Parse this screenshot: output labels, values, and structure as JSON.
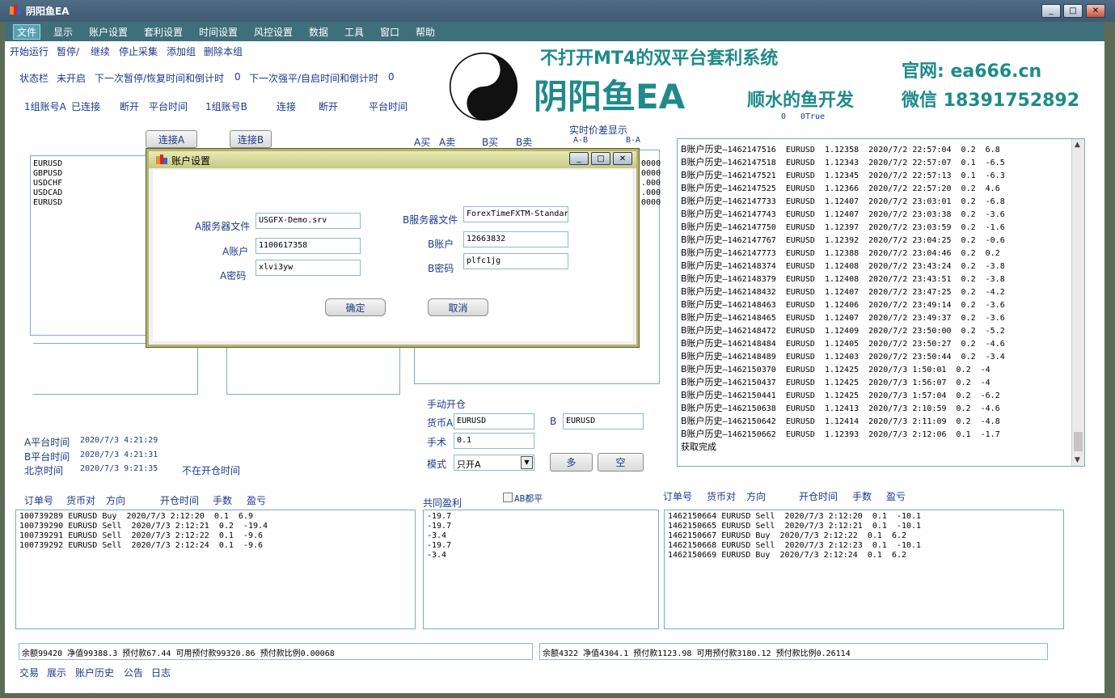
{
  "window": {
    "title": "阴阳鱼EA",
    "min": "_",
    "max": "□",
    "close": "✕"
  },
  "menu": [
    "文件",
    "显示",
    "账户设置",
    "套利设置",
    "时间设置",
    "风控设置",
    "数据",
    "工具",
    "窗口",
    "帮助"
  ],
  "toolbar": [
    "开始运行",
    "暂停/",
    "继续",
    "停止采集",
    "添加组",
    "删除本组"
  ],
  "status": {
    "label": "状态栏",
    "state": "未开启",
    "next_pause": "下一次暂停/恢复时间和倒计时",
    "next_pause_val": "0",
    "next_force": "下一次强平/自启时间和倒计时",
    "next_force_val": "0"
  },
  "group_line": {
    "a_label": "1组账号A",
    "a_state": "已连接",
    "a_disc": "断开",
    "a_time": "平台时间",
    "b_label": "1组账号B",
    "b_conn": "连接",
    "b_disc": "断开",
    "b_time": "平台时间"
  },
  "banner": {
    "slogan": "不打开MT4的双平台套利系统",
    "brand": "阴阳鱼EA",
    "site": "官网: ea666.cn",
    "dev": "顺水的鱼开发",
    "wechat": "微信 18391752892"
  },
  "misc": {
    "zero": "0",
    "otrue": "0True"
  },
  "buttons": {
    "connect_a": "连接A",
    "connect_b": "连接B",
    "long": "多",
    "short": "空",
    "ok": "确定",
    "cancel": "取消"
  },
  "price_table": {
    "title": "实时价差显示",
    "cols": [
      "A买",
      "A卖",
      "B买",
      "B卖",
      "A-B",
      "B-A"
    ],
    "partial": [
      ".0000",
      ".0000",
      ".000",
      ".000",
      ".0000"
    ]
  },
  "symbols": [
    "EURUSD",
    "GBPUSD",
    "USDCHF",
    "USDCAD",
    "EURUSD"
  ],
  "times": {
    "a_label": "A平台时间",
    "a_val": "2020/7/3 4:21:29",
    "b_label": "B平台时间",
    "b_val": "2020/7/3 4:21:31",
    "bj_label": "北京时间",
    "bj_val": "2020/7/3 9:21:35",
    "not_open": "不在开仓时间"
  },
  "manual": {
    "title": "手动开仓",
    "symbol_a_label": "货币A",
    "symbol_a": "EURUSD",
    "b_label": "B",
    "symbol_b": "EURUSD",
    "lots_label": "手术",
    "lots": "0.1",
    "mode_label": "模式",
    "mode": "只开A"
  },
  "history": [
    [
      "B账户历史",
      "—1462147516  EURUSD  1.12358  2020/7/2 22:57:04  0.2  6.8"
    ],
    [
      "B账户历史",
      "—1462147518  EURUSD  1.12343  2020/7/2 22:57:07  0.1  -6.5"
    ],
    [
      "B账户历史",
      "—1462147521  EURUSD  1.12345  2020/7/2 22:57:13  0.1  -6.3"
    ],
    [
      "B账户历史",
      "—1462147525  EURUSD  1.12366  2020/7/2 22:57:20  0.2  4.6"
    ],
    [
      "B账户历史",
      "—1462147733  EURUSD  1.12407  2020/7/2 23:03:01  0.2  -6.8"
    ],
    [
      "B账户历史",
      "—1462147743  EURUSD  1.12407  2020/7/2 23:03:38  0.2  -3.6"
    ],
    [
      "B账户历史",
      "—1462147750  EURUSD  1.12397  2020/7/2 23:03:59  0.2  -1.6"
    ],
    [
      "B账户历史",
      "—1462147767  EURUSD  1.12392  2020/7/2 23:04:25  0.2  -0.6"
    ],
    [
      "B账户历史",
      "—1462147773  EURUSD  1.12388  2020/7/2 23:04:46  0.2  0.2"
    ],
    [
      "B账户历史",
      "—1462148374  EURUSD  1.12408  2020/7/2 23:43:24  0.2  -3.8"
    ],
    [
      "B账户历史",
      "—1462148379  EURUSD  1.12408  2020/7/2 23:43:51  0.2  -3.8"
    ],
    [
      "B账户历史",
      "—1462148432  EURUSD  1.12407  2020/7/2 23:47:25  0.2  -4.2"
    ],
    [
      "B账户历史",
      "—1462148463  EURUSD  1.12406  2020/7/2 23:49:14  0.2  -3.6"
    ],
    [
      "B账户历史",
      "—1462148465  EURUSD  1.12407  2020/7/2 23:49:37  0.2  -3.6"
    ],
    [
      "B账户历史",
      "—1462148472  EURUSD  1.12409  2020/7/2 23:50:00  0.2  -5.2"
    ],
    [
      "B账户历史",
      "—1462148484  EURUSD  1.12405  2020/7/2 23:50:27  0.2  -4.6"
    ],
    [
      "B账户历史",
      "—1462148489  EURUSD  1.12403  2020/7/2 23:50:44  0.2  -3.4"
    ],
    [
      "B账户历史",
      "—1462150370  EURUSD  1.12425  2020/7/3 1:50:01  0.2  -4"
    ],
    [
      "B账户历史",
      "—1462150437  EURUSD  1.12425  2020/7/3 1:56:07  0.2  -4"
    ],
    [
      "B账户历史",
      "—1462150441  EURUSD  1.12425  2020/7/3 1:57:04  0.2  -6.2"
    ],
    [
      "B账户历史",
      "—1462150638  EURUSD  1.12413  2020/7/3 2:10:59  0.2  -4.6"
    ],
    [
      "B账户历史",
      "—1462150642  EURUSD  1.12414  2020/7/3 2:11:09  0.2  -4.8"
    ],
    [
      "B账户历史",
      "—1462150662  EURUSD  1.12393  2020/7/3 2:12:06  0.1  -1.7"
    ]
  ],
  "history_done": "获取完成",
  "order_cols": [
    "订单号",
    "货币对",
    "方向",
    "开仓时间",
    "手数",
    "盈亏"
  ],
  "orders_a": [
    "100739289 EURUSD Buy  2020/7/3 2:12:20  0.1  6.9",
    "100739290 EURUSD Sell  2020/7/3 2:12:21  0.2  -19.4",
    "100739291 EURUSD Sell  2020/7/3 2:12:22  0.1  -9.6",
    "100739292 EURUSD Sell  2020/7/3 2:12:24  0.1  -9.6"
  ],
  "common": {
    "title": "共同盈利",
    "ab_close": "AB都平",
    "values": [
      "-19.7",
      "-19.7",
      "-3.4",
      "-19.7",
      "-3.4"
    ]
  },
  "orders_b": [
    "1462150664 EURUSD Sell  2020/7/3 2:12:20  0.1  -10.1",
    "1462150665 EURUSD Sell  2020/7/3 2:12:21  0.1  -10.1",
    "1462150667 EURUSD Buy  2020/7/3 2:12:22  0.1  6.2",
    "1462150668 EURUSD Sell  2020/7/3 2:12:23  0.1  -10.1",
    "1462150669 EURUSD Buy  2020/7/3 2:12:24  0.1  6.2"
  ],
  "account_a": "余额99420  净值99388.3  预付款67.44  可用预付款99320.86  预付款比例0.00068",
  "account_b": "余额4322  净值4304.1  预付款1123.98  可用预付款3180.12  预付款比例0.26114",
  "bottom_tabs": [
    "交易",
    "展示",
    "账户历史",
    "公告",
    "日志"
  ],
  "dialog": {
    "title": "账户设置",
    "a_server_label": "A服务器文件",
    "a_server": "USGFX-Demo.srv",
    "a_account_label": "A账户",
    "a_account": "1100617358",
    "a_pass_label": "A密码",
    "a_pass": "xlvi3yw",
    "b_server_label": "B服务器文件",
    "b_server": "ForexTimeFXTM-Standar",
    "b_account_label": "B账户",
    "b_account": "12663832",
    "b_pass_label": "B密码",
    "b_pass": "plfc1jg"
  },
  "colors": {
    "menu_bg": "#3f6f7b",
    "banner": "#1f8a8a",
    "label": "#1a3a8a"
  }
}
